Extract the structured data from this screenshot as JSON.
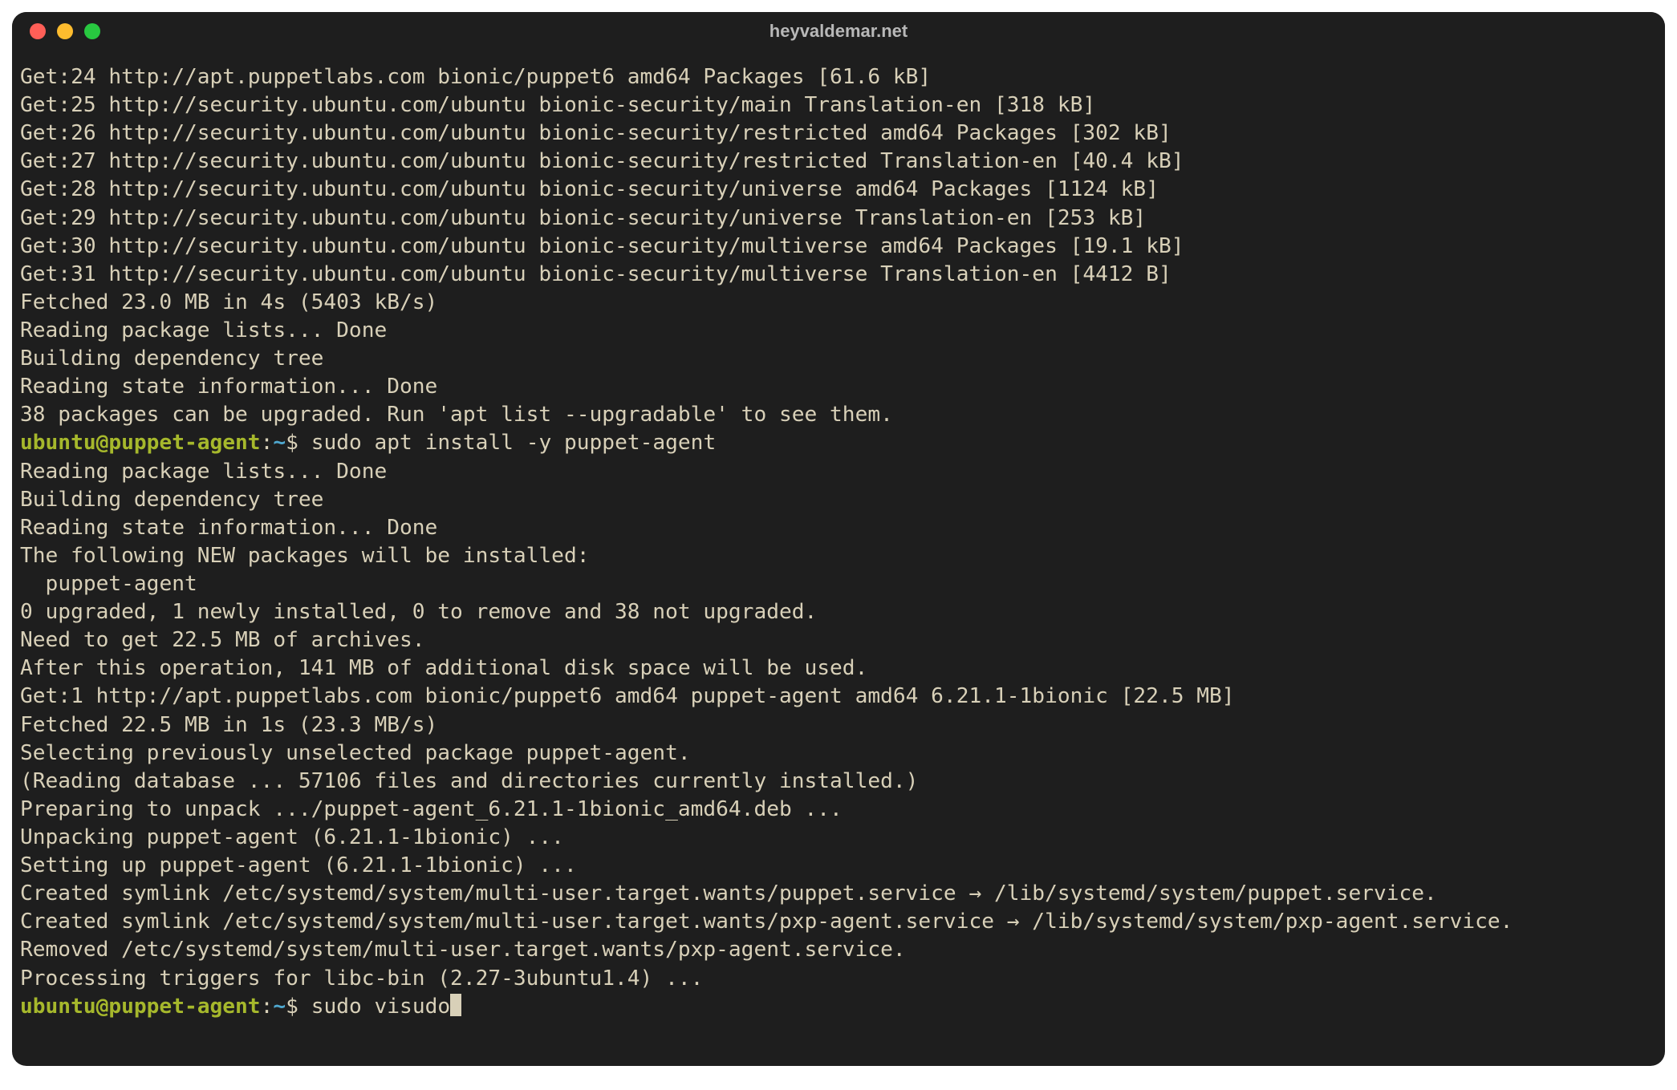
{
  "window": {
    "title": "heyvaldemar.net",
    "traffic_lights": [
      "close",
      "minimize",
      "zoom"
    ]
  },
  "colors": {
    "bg": "#1e1e1e",
    "fg": "#d8d0b8",
    "user": "#a6b82c",
    "path": "#4fa8cf",
    "traffic_red": "#ff5f57",
    "traffic_yellow": "#febc2e",
    "traffic_green": "#28c840"
  },
  "prompt": {
    "user_host": "ubuntu@puppet-agent",
    "sep": ":",
    "path": "~",
    "symbol": "$"
  },
  "lines": [
    {
      "t": "out",
      "text": "Get:24 http://apt.puppetlabs.com bionic/puppet6 amd64 Packages [61.6 kB]"
    },
    {
      "t": "out",
      "text": "Get:25 http://security.ubuntu.com/ubuntu bionic-security/main Translation-en [318 kB]"
    },
    {
      "t": "out",
      "text": "Get:26 http://security.ubuntu.com/ubuntu bionic-security/restricted amd64 Packages [302 kB]"
    },
    {
      "t": "out",
      "text": "Get:27 http://security.ubuntu.com/ubuntu bionic-security/restricted Translation-en [40.4 kB]"
    },
    {
      "t": "out",
      "text": "Get:28 http://security.ubuntu.com/ubuntu bionic-security/universe amd64 Packages [1124 kB]"
    },
    {
      "t": "out",
      "text": "Get:29 http://security.ubuntu.com/ubuntu bionic-security/universe Translation-en [253 kB]"
    },
    {
      "t": "out",
      "text": "Get:30 http://security.ubuntu.com/ubuntu bionic-security/multiverse amd64 Packages [19.1 kB]"
    },
    {
      "t": "out",
      "text": "Get:31 http://security.ubuntu.com/ubuntu bionic-security/multiverse Translation-en [4412 B]"
    },
    {
      "t": "out",
      "text": "Fetched 23.0 MB in 4s (5403 kB/s)"
    },
    {
      "t": "out",
      "text": "Reading package lists... Done"
    },
    {
      "t": "out",
      "text": "Building dependency tree"
    },
    {
      "t": "out",
      "text": "Reading state information... Done"
    },
    {
      "t": "out",
      "text": "38 packages can be upgraded. Run 'apt list --upgradable' to see them."
    },
    {
      "t": "prompt",
      "cmd": "sudo apt install -y puppet-agent"
    },
    {
      "t": "out",
      "text": "Reading package lists... Done"
    },
    {
      "t": "out",
      "text": "Building dependency tree"
    },
    {
      "t": "out",
      "text": "Reading state information... Done"
    },
    {
      "t": "out",
      "text": "The following NEW packages will be installed:"
    },
    {
      "t": "out",
      "text": "  puppet-agent"
    },
    {
      "t": "out",
      "text": "0 upgraded, 1 newly installed, 0 to remove and 38 not upgraded."
    },
    {
      "t": "out",
      "text": "Need to get 22.5 MB of archives."
    },
    {
      "t": "out",
      "text": "After this operation, 141 MB of additional disk space will be used."
    },
    {
      "t": "out",
      "text": "Get:1 http://apt.puppetlabs.com bionic/puppet6 amd64 puppet-agent amd64 6.21.1-1bionic [22.5 MB]"
    },
    {
      "t": "out",
      "text": "Fetched 22.5 MB in 1s (23.3 MB/s)"
    },
    {
      "t": "out",
      "text": "Selecting previously unselected package puppet-agent."
    },
    {
      "t": "out",
      "text": "(Reading database ... 57106 files and directories currently installed.)"
    },
    {
      "t": "out",
      "text": "Preparing to unpack .../puppet-agent_6.21.1-1bionic_amd64.deb ..."
    },
    {
      "t": "out",
      "text": "Unpacking puppet-agent (6.21.1-1bionic) ..."
    },
    {
      "t": "out",
      "text": "Setting up puppet-agent (6.21.1-1bionic) ..."
    },
    {
      "t": "out",
      "text": "Created symlink /etc/systemd/system/multi-user.target.wants/puppet.service → /lib/systemd/system/puppet.service."
    },
    {
      "t": "out",
      "text": "Created symlink /etc/systemd/system/multi-user.target.wants/pxp-agent.service → /lib/systemd/system/pxp-agent.service."
    },
    {
      "t": "out",
      "text": "Removed /etc/systemd/system/multi-user.target.wants/pxp-agent.service."
    },
    {
      "t": "out",
      "text": "Processing triggers for libc-bin (2.27-3ubuntu1.4) ..."
    },
    {
      "t": "prompt",
      "cmd": "sudo visudo",
      "cursor": true
    }
  ]
}
